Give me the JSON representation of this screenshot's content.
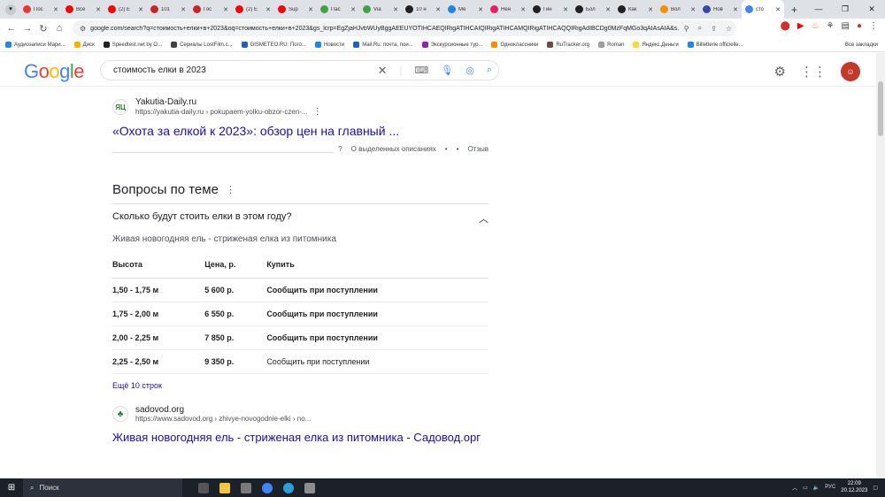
{
  "browser": {
    "tabs": [
      {
        "label": "Пос",
        "color": "#e53935"
      },
      {
        "label": "Все",
        "color": "#ff0000"
      },
      {
        "label": "(2) Е",
        "color": "#ff0000"
      },
      {
        "label": "101",
        "color": "#c62828"
      },
      {
        "label": "Гос",
        "color": "#c62828"
      },
      {
        "label": "(2) Е",
        "color": "#ff0000"
      },
      {
        "label": "Sup",
        "color": "#ff0000"
      },
      {
        "label": "Пас",
        "color": "#43a047"
      },
      {
        "label": "Via",
        "color": "#43a047"
      },
      {
        "label": "10 н",
        "color": "#212121"
      },
      {
        "label": "Ме",
        "color": "#1e88e5"
      },
      {
        "label": "Нен",
        "color": "#e91e63"
      },
      {
        "label": "Гин",
        "color": "#212121"
      },
      {
        "label": "Бол",
        "color": "#212121"
      },
      {
        "label": "Как",
        "color": "#212121"
      },
      {
        "label": "Вол",
        "color": "#fb8c00"
      },
      {
        "label": "Нов",
        "color": "#3949ab"
      },
      {
        "label": "сто",
        "color": "#4285f4",
        "active": true
      }
    ],
    "url": "google.com/search?q=стоимость+елки+в+2023&oq=стоимость+елки+в+2023&gs_lcrp=EgZjaHJvbWUyBggAEEUYOTIHCAEQIRigATIHCAIQIRigATIHCAMQIRigATIHCAQQIRigAdIBCDg0MzFqMGo3qAIAsAIA&s...",
    "bookmarks": [
      {
        "label": "Аудиозаписи Мари...",
        "color": "#1e88e5"
      },
      {
        "label": "Диск",
        "color": "#f4b400"
      },
      {
        "label": "Speedtest.net by O...",
        "color": "#212121"
      },
      {
        "label": "Сериалы LostFilm.c...",
        "color": "#424242"
      },
      {
        "label": "GISMETEO.RU: Пого...",
        "color": "#1565c0"
      },
      {
        "label": "Новости",
        "color": "#1e88e5"
      },
      {
        "label": "Mail.Ru: почта, пои...",
        "color": "#1565c0"
      },
      {
        "label": "Экскурсионные тур...",
        "color": "#8e24aa"
      },
      {
        "label": "Одноклассники",
        "color": "#fb8c00"
      },
      {
        "label": "RuTracker.org",
        "color": "#6d4c41"
      },
      {
        "label": "Roman",
        "color": "#9e9e9e"
      },
      {
        "label": "Яндекс.Деньги",
        "color": "#fdd835"
      },
      {
        "label": "Billetterie officielle...",
        "color": "#1e88e5"
      }
    ],
    "all_bookmarks": "Все закладки"
  },
  "google": {
    "logo": "Google",
    "query": "стоимость елки в 2023"
  },
  "result1": {
    "site_icon": "ЯЦ",
    "site_name": "Yakutia-Daily.ru",
    "site_url": "https://yakutia-daily.ru › pokupaem-yolku-obzor-czen-...",
    "title": "«Охота за елкой к 2023»: обзор цен на главный ...",
    "about": "О выделенных описаниях",
    "feedback": "Отзыв"
  },
  "paa": {
    "title": "Вопросы по теме",
    "question": "Сколько будут стоить елки в этом году?",
    "subtitle": "Живая новогодняя ель - стриженая елка из питомника",
    "headers": [
      "Высота",
      "Цена, р.",
      "Купить"
    ],
    "rows": [
      {
        "height": "1,50 - 1,75 м",
        "price": "5 600 р.",
        "buy": "Сообщить при поступлении",
        "bold": true
      },
      {
        "height": "1,75 - 2,00 м",
        "price": "6 550 р.",
        "buy": "Сообщить при поступлении",
        "bold": true
      },
      {
        "height": "2,00 - 2,25 м",
        "price": "7 850 р.",
        "buy": "Сообщить при поступлении",
        "bold": true
      },
      {
        "height": "2,25 - 2,50 м",
        "price": "9 350 р.",
        "buy": "Сообщить при поступлении",
        "bold": false
      }
    ],
    "more": "Ещё 10 строк"
  },
  "result2": {
    "site_name": "sadovod.org",
    "site_url": "https://www.sadovod.org › zhivye-novogodnie-elki › no...",
    "title": "Живая новогодняя ель - стриженая елка из питомника - Садовод.орг"
  },
  "taskbar": {
    "search": "Поиск",
    "lang": "РУС",
    "time": "22:09",
    "date": "20.12.2023"
  }
}
